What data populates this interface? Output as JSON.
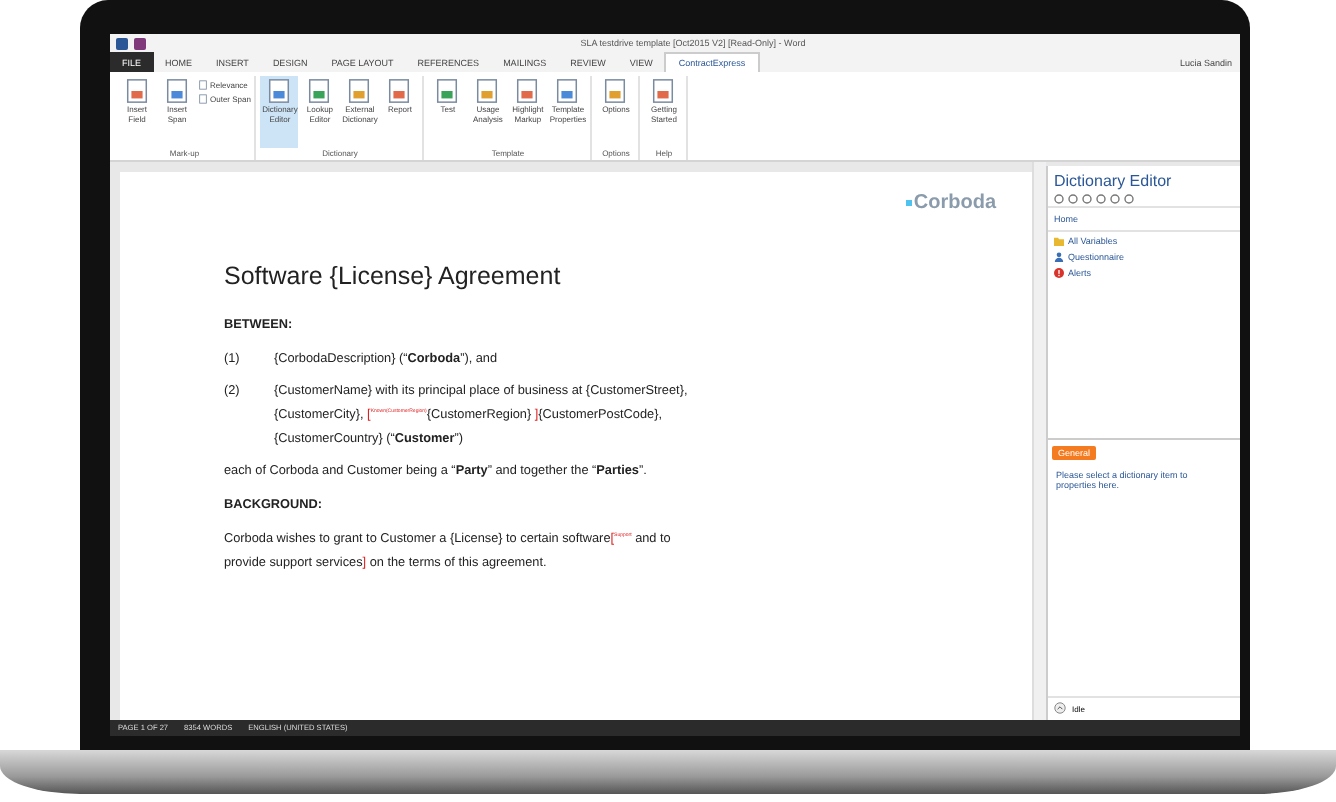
{
  "window": {
    "title": "SLA testdrive template [Oct2015 V2] [Read-Only] - Word",
    "user": "Lucia Sandin"
  },
  "tabs": [
    {
      "label": "FILE",
      "selected": false,
      "kind": "file"
    },
    {
      "label": "HOME",
      "selected": false,
      "kind": "tab"
    },
    {
      "label": "INSERT",
      "selected": false,
      "kind": "tab"
    },
    {
      "label": "DESIGN",
      "selected": false,
      "kind": "tab"
    },
    {
      "label": "PAGE LAYOUT",
      "selected": false,
      "kind": "tab"
    },
    {
      "label": "REFERENCES",
      "selected": false,
      "kind": "tab"
    },
    {
      "label": "MAILINGS",
      "selected": false,
      "kind": "tab"
    },
    {
      "label": "REVIEW",
      "selected": false,
      "kind": "tab"
    },
    {
      "label": "VIEW",
      "selected": false,
      "kind": "tab"
    },
    {
      "label": "ContractExpress",
      "selected": true,
      "kind": "tab"
    }
  ],
  "ribbon_groups": [
    {
      "label": "Mark-up",
      "buttons": [
        {
          "label": "Insert Field",
          "kind": "large",
          "selected": false
        },
        {
          "label": "Insert Span",
          "kind": "large",
          "selected": false
        },
        {
          "label": "Relevance",
          "kind": "small",
          "selected": false
        },
        {
          "label": "Outer Span",
          "kind": "small",
          "selected": false
        }
      ]
    },
    {
      "label": "Dictionary",
      "buttons": [
        {
          "label": "Dictionary Editor",
          "kind": "large",
          "selected": true
        },
        {
          "label": "Lookup Editor",
          "kind": "large",
          "selected": false
        },
        {
          "label": "External Dictionary",
          "kind": "large",
          "selected": false
        },
        {
          "label": "Report",
          "kind": "large",
          "selected": false
        }
      ]
    },
    {
      "label": "Template",
      "buttons": [
        {
          "label": "Test",
          "kind": "large",
          "selected": false
        },
        {
          "label": "Usage Analysis",
          "kind": "large",
          "selected": false
        },
        {
          "label": "Highlight Markup",
          "kind": "large",
          "selected": false
        },
        {
          "label": "Template Properties",
          "kind": "large",
          "selected": false
        }
      ]
    },
    {
      "label": "Options",
      "buttons": [
        {
          "label": "Options",
          "kind": "large",
          "selected": false
        }
      ]
    },
    {
      "label": "Help",
      "buttons": [
        {
          "label": "Getting Started",
          "kind": "large",
          "selected": false
        }
      ]
    }
  ],
  "document": {
    "logo": "Corboda",
    "title": "Software {License} Agreement",
    "blocks": [
      {
        "kind": "heading",
        "text": "BETWEEN:"
      },
      {
        "kind": "item",
        "number": "(1)",
        "lines": [
          [
            {
              "kind": "plain",
              "text": "{CorbodaDescription} (“"
            },
            {
              "kind": "bold",
              "text": "Corboda"
            },
            {
              "kind": "plain",
              "text": "”), and"
            }
          ]
        ]
      },
      {
        "kind": "item",
        "number": "(2)",
        "lines": [
          [
            {
              "kind": "plain",
              "text": "{CustomerName} with its principal place of business at {CustomerStreet},"
            }
          ],
          [
            {
              "kind": "plain",
              "text": "{CustomerCity}, "
            },
            {
              "kind": "markup",
              "text": "[",
              "note": "Known(CustomerRegion)"
            },
            {
              "kind": "plain",
              "text": "{CustomerRegion} "
            },
            {
              "kind": "markup",
              "text": "]"
            },
            {
              "kind": "plain",
              "text": "{CustomerPostCode},"
            }
          ],
          [
            {
              "kind": "plain",
              "text": "{CustomerCountry} (“"
            },
            {
              "kind": "bold",
              "text": "Customer"
            },
            {
              "kind": "plain",
              "text": "”)"
            }
          ]
        ]
      },
      {
        "kind": "para",
        "lines": [
          [
            {
              "kind": "plain",
              "text": "each of Corboda and Customer being a “"
            },
            {
              "kind": "bold",
              "text": "Party"
            },
            {
              "kind": "plain",
              "text": "” and together the “"
            },
            {
              "kind": "bold",
              "text": "Parties"
            },
            {
              "kind": "plain",
              "text": "”."
            }
          ]
        ]
      },
      {
        "kind": "heading",
        "text": "BACKGROUND:"
      },
      {
        "kind": "para",
        "lines": [
          [
            {
              "kind": "plain",
              "text": "Corboda wishes to grant to Customer a {License} to certain software"
            },
            {
              "kind": "markup",
              "text": "[",
              "note": "Support"
            },
            {
              "kind": "plain",
              "text": " and to"
            }
          ],
          [
            {
              "kind": "plain",
              "text": "provide support services"
            },
            {
              "kind": "markup",
              "text": "]"
            },
            {
              "kind": "plain",
              "text": " on the terms of this agreement."
            }
          ]
        ]
      }
    ]
  },
  "pane": {
    "title": "Dictionary Editor",
    "breadcrumb": "Home",
    "items": [
      {
        "label": "All Variables",
        "kind": "folder"
      },
      {
        "label": "Questionnaire",
        "kind": "people"
      },
      {
        "label": "Alerts",
        "kind": "alert"
      }
    ],
    "tab": "General",
    "message_lines": [
      "Please select a dictionary item to",
      "properties here."
    ],
    "status": "Idle"
  },
  "status_bar": {
    "page": "PAGE 1 OF 27",
    "words": "8354 WORDS",
    "language": "ENGLISH (UNITED STATES)"
  }
}
